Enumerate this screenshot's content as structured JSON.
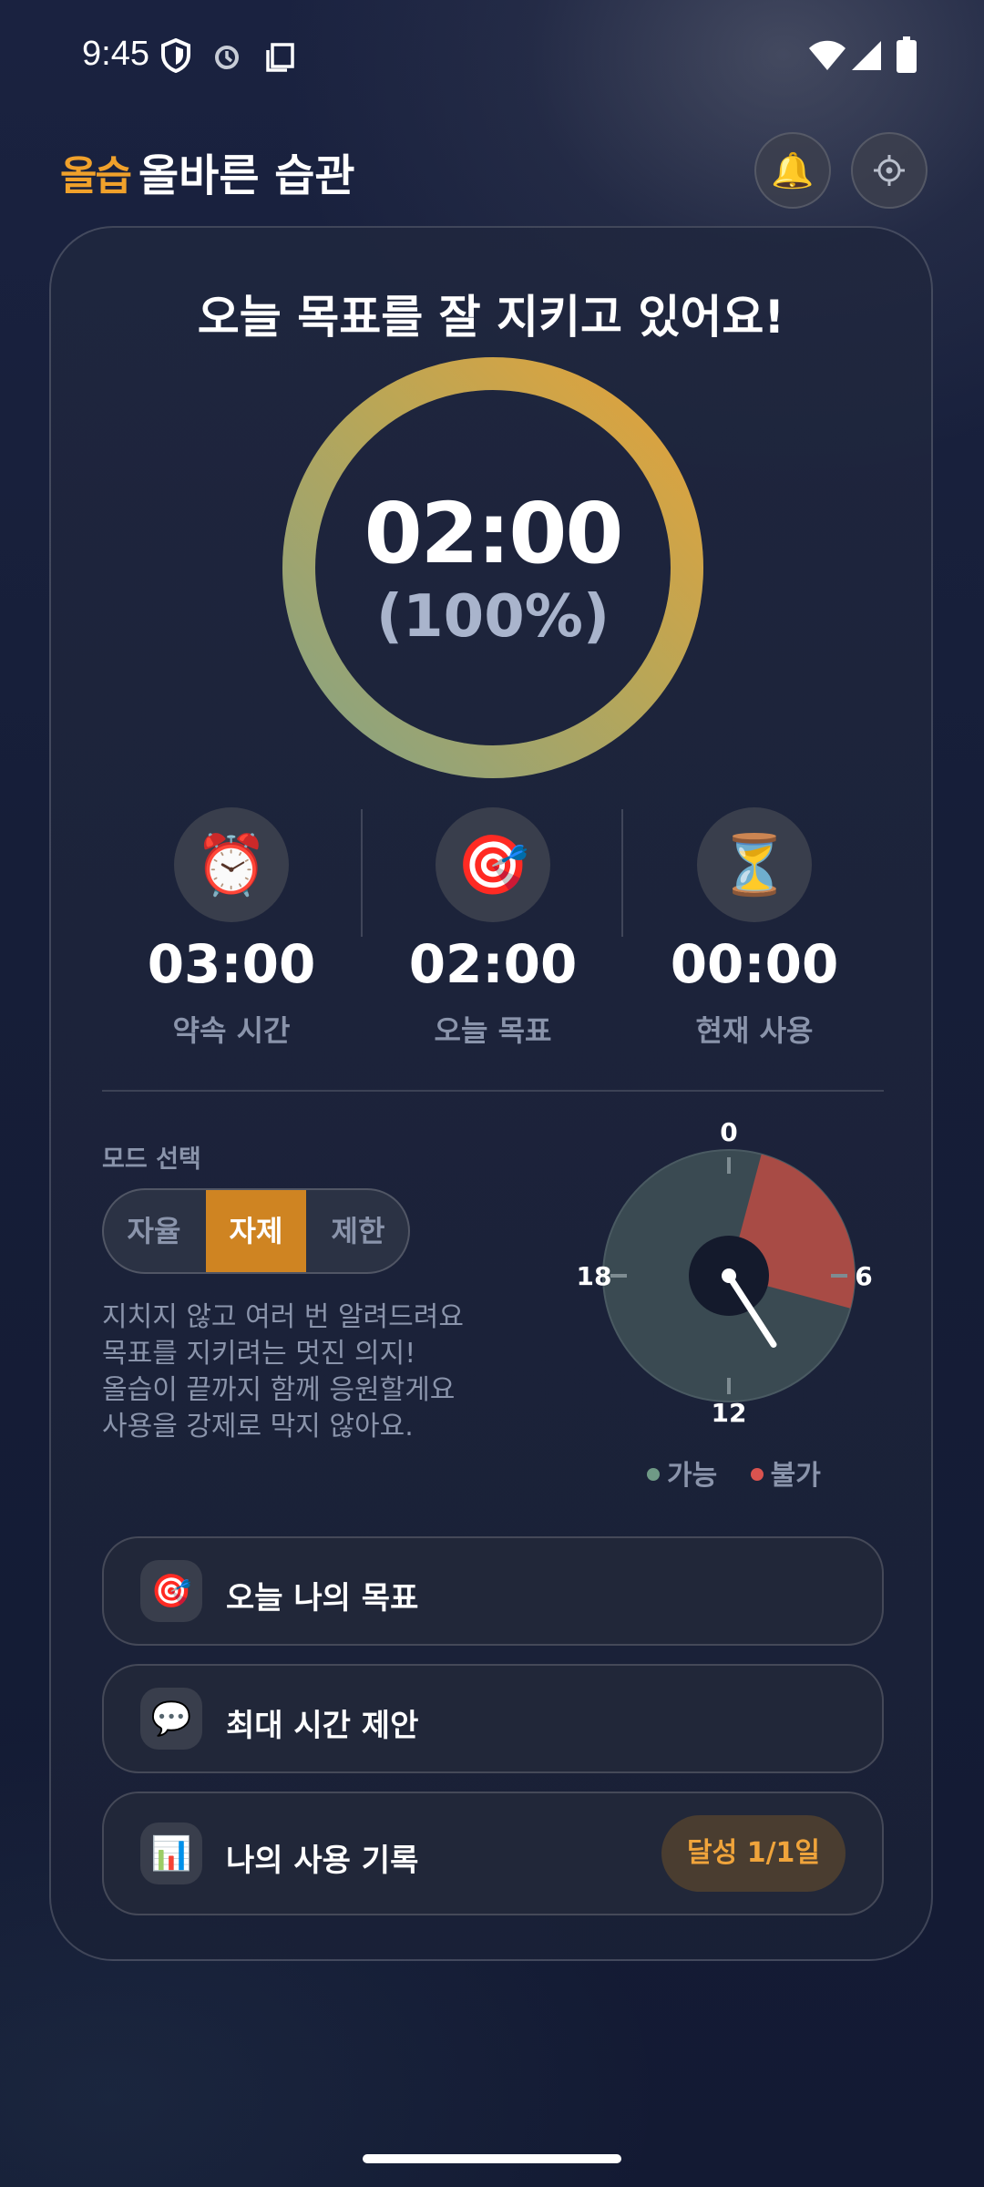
{
  "status_bar": {
    "time": "9:45"
  },
  "header": {
    "logo": "올습",
    "title": "올바른 습관",
    "bell_icon": "🔔",
    "settings_icon": "⚙"
  },
  "summary": {
    "heading": "오늘 목표를 잘 지키고 있어요!",
    "remaining_time": "02:00",
    "percent_text": "(100%)",
    "progress_fraction": 1.0
  },
  "stats": [
    {
      "icon": "⏰",
      "icon_name": "alarm-clock-icon",
      "value": "03:00",
      "label": "약속 시간"
    },
    {
      "icon": "🎯",
      "icon_name": "target-icon",
      "value": "02:00",
      "label": "오늘 목표"
    },
    {
      "icon": "⏳",
      "icon_name": "hourglass-icon",
      "value": "00:00",
      "label": "현재 사용"
    }
  ],
  "mode": {
    "title": "모드 선택",
    "options": [
      "자율",
      "자제",
      "제한"
    ],
    "selected": "자제",
    "description": [
      "지치지 않고 여러 번 알려드려요",
      "목표를 지키려는 멋진 의지!",
      "올습이 끝까지 함께 응원할게요",
      "사용을 강제로 막지 않아요."
    ]
  },
  "dial": {
    "labels": [
      "0",
      "6",
      "12",
      "18"
    ],
    "restricted_start_hour": 1,
    "restricted_end_hour": 7,
    "current_hour": 9.8,
    "legend": [
      {
        "label": "가능",
        "color": "#6f9a86"
      },
      {
        "label": "불가",
        "color": "#d9534f"
      }
    ]
  },
  "actions": [
    {
      "icon": "🎯",
      "icon_name": "target-icon",
      "label": "오늘 나의 목표"
    },
    {
      "icon": "💬",
      "icon_name": "speech-bubble-icon",
      "label": "최대 시간 제안"
    },
    {
      "icon": "📊",
      "icon_name": "bar-chart-icon",
      "label": "나의 사용 기록",
      "badge": "달성 1/1일"
    }
  ],
  "colors": {
    "accent": "#cf8422",
    "ring_start": "#8da47e",
    "ring_end": "#e0a33e",
    "dial_available": "#3b4a52",
    "dial_restricted": "#a84b45"
  }
}
